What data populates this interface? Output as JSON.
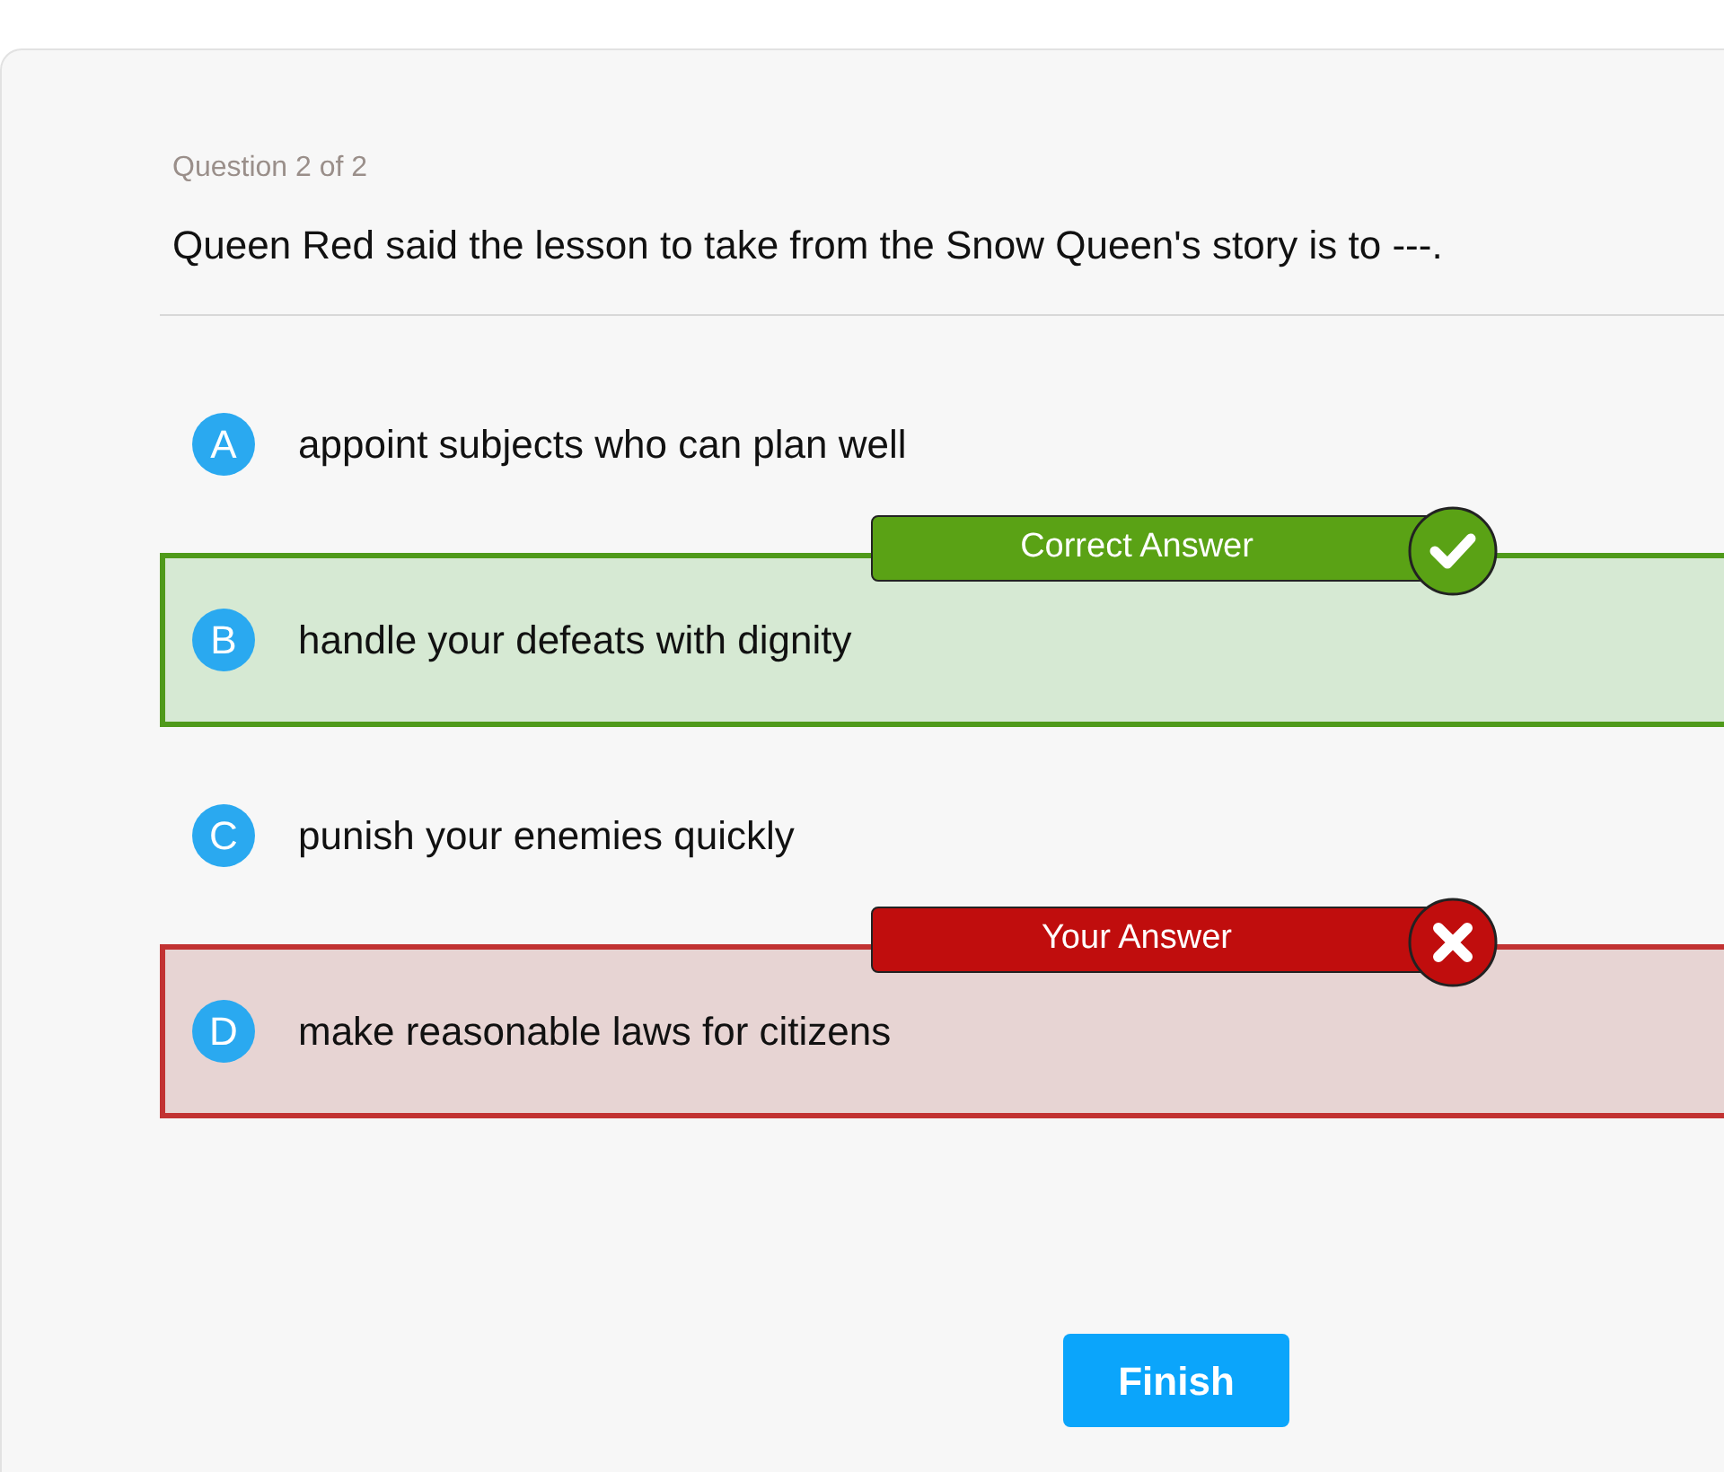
{
  "progress": "Question 2 of 2",
  "question": "Queen Red said the lesson to take from the Snow Queen's story is to ---.",
  "options": [
    {
      "letter": "A",
      "text": "appoint subjects who can plan well",
      "kind": "plain"
    },
    {
      "letter": "B",
      "text": "handle your defeats with dignity",
      "kind": "correct",
      "banner": "Correct Answer"
    },
    {
      "letter": "C",
      "text": "punish your enemies quickly",
      "kind": "plain"
    },
    {
      "letter": "D",
      "text": "make reasonable laws for citizens",
      "kind": "wrong",
      "banner": "Your Answer"
    }
  ],
  "finish_button": "Finish"
}
